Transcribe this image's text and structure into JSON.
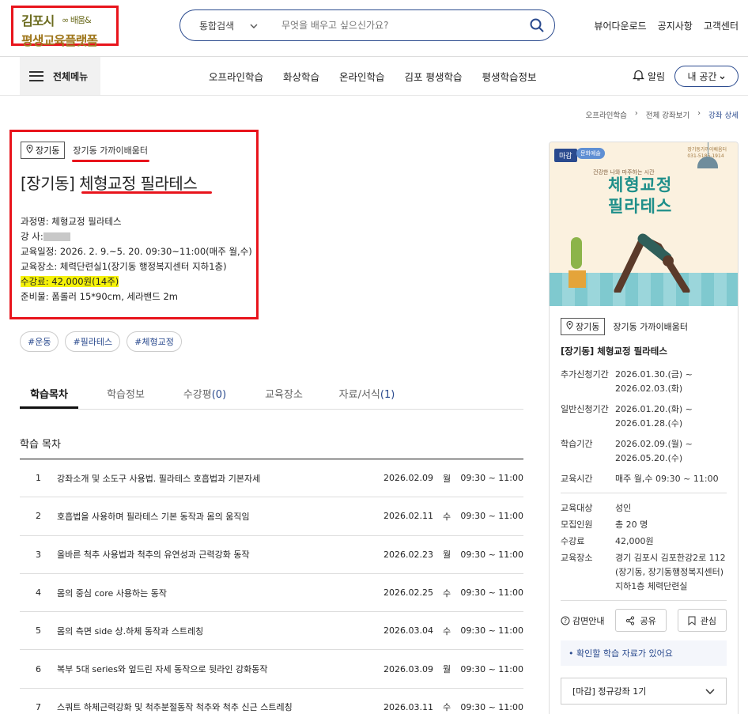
{
  "header": {
    "logo_line1": "김포시",
    "logo_glasses_text": "배움&",
    "logo_line2": "평생교육플랫폼",
    "search_category": "통합검색",
    "search_placeholder": "무엇을 배우고 싶으신가요?",
    "links": [
      "뷰어다운로드",
      "공지사항",
      "고객센터"
    ]
  },
  "nav": {
    "all_menu": "전체메뉴",
    "items": [
      "오프라인학습",
      "화상학습",
      "온라인학습",
      "김포 평생학습",
      "평생학습정보"
    ],
    "alarm": "알림",
    "my_space": "내 공간"
  },
  "breadcrumb": [
    "오프라인학습",
    "전체 강좌보기",
    "강좌 상세"
  ],
  "course": {
    "location_chip": "장기동",
    "location_name": "장기동 가까이배움터",
    "title_prefix": "[장기동] ",
    "title_main": "체형교정 필라테스",
    "lines": [
      "과정명: 체형교정 필라테스",
      "강 사:",
      "교육일정: 2026. 2. 9.~5. 20. 09:30~11:00(매주 월,수)",
      "교육장소: 체력단련실1(장기동 행정복지센터 지하1층)",
      "수강료: 42,000원(14주)",
      "준비물: 폼롤러 15*90cm, 세라밴드 2m"
    ],
    "tags": [
      "#운동",
      "#필라테스",
      "#체형교정"
    ]
  },
  "tabs": [
    {
      "label": "학습목차",
      "count": ""
    },
    {
      "label": "학습정보",
      "count": ""
    },
    {
      "label": "수강평",
      "count": "(0)"
    },
    {
      "label": "교육장소",
      "count": ""
    },
    {
      "label": "자료/서식",
      "count": "(1)"
    }
  ],
  "toc": {
    "title": "학습 목차",
    "rows": [
      {
        "no": "1",
        "text": "강좌소개 및 소도구 사용법. 필라테스 호흡법과 기본자세",
        "date": "2026.02.09",
        "day": "월",
        "time": "09:30 ~ 11:00"
      },
      {
        "no": "2",
        "text": "호흡법을 사용하며 필라테스 기본 동작과 몸의 움직임",
        "date": "2026.02.11",
        "day": "수",
        "time": "09:30 ~ 11:00"
      },
      {
        "no": "3",
        "text": "올바른 척추 사용법과 척추의 유연성과 근력강화 동작",
        "date": "2026.02.23",
        "day": "월",
        "time": "09:30 ~ 11:00"
      },
      {
        "no": "4",
        "text": "몸의 중심 core 사용하는 동작",
        "date": "2026.02.25",
        "day": "수",
        "time": "09:30 ~ 11:00"
      },
      {
        "no": "5",
        "text": "몸의 측면 side 상.하체 동작과 스트레칭",
        "date": "2026.03.04",
        "day": "수",
        "time": "09:30 ~ 11:00"
      },
      {
        "no": "6",
        "text": "복부 5대 series와 엎드린 자세 동작으로 뒷라인 강화동작",
        "date": "2026.03.09",
        "day": "월",
        "time": "09:30 ~ 11:00"
      },
      {
        "no": "7",
        "text": "스쿼트 하체근력강화 및 척추분절동작 척추와 척추 신근 스트레칭",
        "date": "2026.03.11",
        "day": "수",
        "time": "09:30 ~ 11:00"
      }
    ]
  },
  "card": {
    "closed_badge": "마감",
    "poster_tag": "문화예술",
    "poster_org_line1": "장기동가까이배움터",
    "poster_org_line2": "031-5186-1914",
    "poster_sub": "건강한 나와 마주하는 시간",
    "poster_title_l1": "체형교정",
    "poster_title_l2": "필라테스",
    "location_chip": "장기동",
    "location_name": "장기동 가까이배움터",
    "title": "[장기동] 체형교정 필라테스",
    "schedule": [
      {
        "k": "추가신청기간",
        "v": [
          "2026.01.30.(금) ~",
          "2026.02.03.(화)"
        ]
      },
      {
        "k": "일반신청기간",
        "v": [
          "2026.01.20.(화) ~",
          "2026.01.28.(수)"
        ]
      },
      {
        "k": "학습기간",
        "v": [
          "2026.02.09.(월) ~",
          "2026.05.20.(수)"
        ]
      },
      {
        "k": "교육시간",
        "v": [
          "매주 월,수 09:30 ~ 11:00"
        ]
      }
    ],
    "details": [
      {
        "k": "교육대상",
        "v": [
          "성인"
        ]
      },
      {
        "k": "모집인원",
        "v": [
          "총 20 명"
        ]
      },
      {
        "k": "수강료",
        "v": [
          "42,000원"
        ]
      },
      {
        "k": "교육장소",
        "v": [
          "경기 김포시 김포한강2로 112",
          "(장기동, 장기동행정복지센터)",
          "지하1층 체력단련실"
        ]
      }
    ],
    "guide": "감면안내",
    "share": "공유",
    "like": "관심",
    "notice": "확인할 학습 자료가 있어요",
    "select": "[마감] 정규강좌 1기"
  }
}
